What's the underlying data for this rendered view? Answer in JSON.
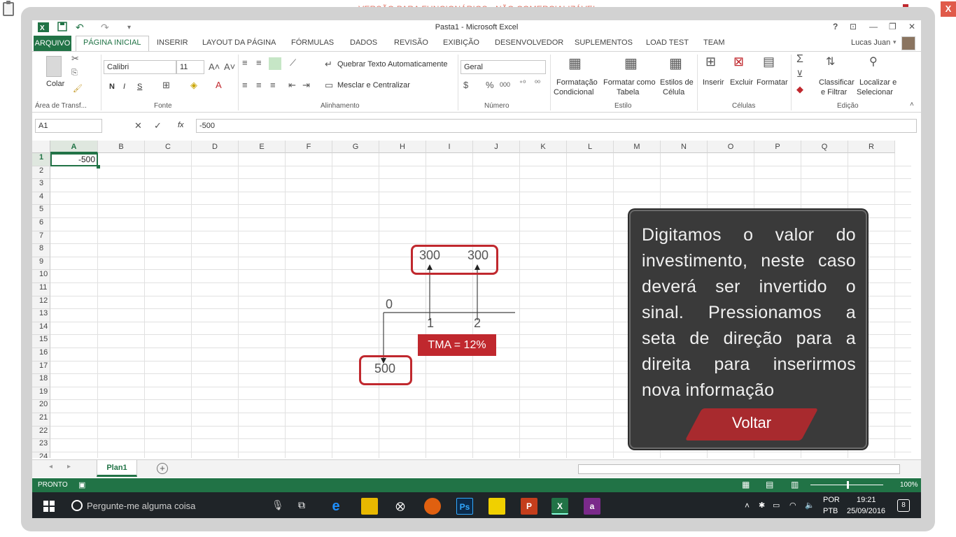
{
  "notice": "VERSÃO PARA FUNCIONÁRIOS - NÃO COMERCIALIZÁVEL",
  "close_label": "X",
  "window": {
    "title": "Pasta1 - Microsoft Excel",
    "help": "?",
    "user": "Lucas Juan"
  },
  "tabs": [
    "ARQUIVO",
    "PÁGINA INICIAL",
    "INSERIR",
    "LAYOUT DA PÁGINA",
    "FÓRMULAS",
    "DADOS",
    "REVISÃO",
    "EXIBIÇÃO",
    "DESENVOLVEDOR",
    "SUPLEMENTOS",
    "LOAD TEST",
    "TEAM"
  ],
  "ribbon": {
    "clipboard": {
      "paste": "Colar",
      "group": "Área de Transf..."
    },
    "font": {
      "name": "Calibri",
      "size": "11",
      "bold": "N",
      "italic": "I",
      "underline": "S",
      "group": "Fonte"
    },
    "alignment": {
      "wrap": "Quebrar Texto Automaticamente",
      "merge": "Mesclar e Centralizar",
      "group": "Alinhamento"
    },
    "number": {
      "format": "Geral",
      "group": "Número"
    },
    "styles": {
      "cond1": "Formatação",
      "cond2": "Condicional",
      "table1": "Formatar como",
      "table2": "Tabela",
      "cell1": "Estilos de",
      "cell2": "Célula",
      "group": "Estilo"
    },
    "cells": {
      "insert": "Inserir",
      "delete": "Excluir",
      "format": "Formatar",
      "group": "Células"
    },
    "editing": {
      "sort1": "Classificar",
      "sort2": "e Filtrar",
      "find1": "Localizar e",
      "find2": "Selecionar",
      "group": "Edição"
    }
  },
  "formula_bar": {
    "name_box": "A1",
    "fx": "fx",
    "value": "-500"
  },
  "columns": [
    "A",
    "B",
    "C",
    "D",
    "E",
    "F",
    "G",
    "H",
    "I",
    "J",
    "K",
    "L",
    "M",
    "N",
    "O",
    "P",
    "Q",
    "R"
  ],
  "rows": [
    "1",
    "2",
    "3",
    "4",
    "5",
    "6",
    "7",
    "8",
    "9",
    "10",
    "11",
    "12",
    "13",
    "14",
    "15",
    "16",
    "17",
    "18",
    "19",
    "20",
    "21",
    "22",
    "23",
    "24"
  ],
  "cell_a1": "-500",
  "sheet": {
    "name": "Plan1",
    "add": "+"
  },
  "status": {
    "mode": "PRONTO",
    "zoom": "100%"
  },
  "taskbar": {
    "search": "Pergunte-me alguma coisa",
    "lang1": "POR",
    "lang2": "PTB",
    "time": "19:21",
    "date": "25/09/2016",
    "notif": "8"
  },
  "diagram": {
    "v1": "300",
    "v2": "300",
    "t0": "0",
    "t1": "1",
    "t2": "2",
    "tma": "TMA = 12%",
    "v0": "500"
  },
  "callout": {
    "text": "Digitamos o valor do investimento, neste caso deverá ser invertido o sinal. Pressionamos a seta de direção para a direita para inserirmos nova informação",
    "button": "Voltar"
  },
  "colors": {
    "excel_green": "#217346",
    "accent_red": "#c0282e",
    "callout_bg": "#3a3a3a"
  }
}
